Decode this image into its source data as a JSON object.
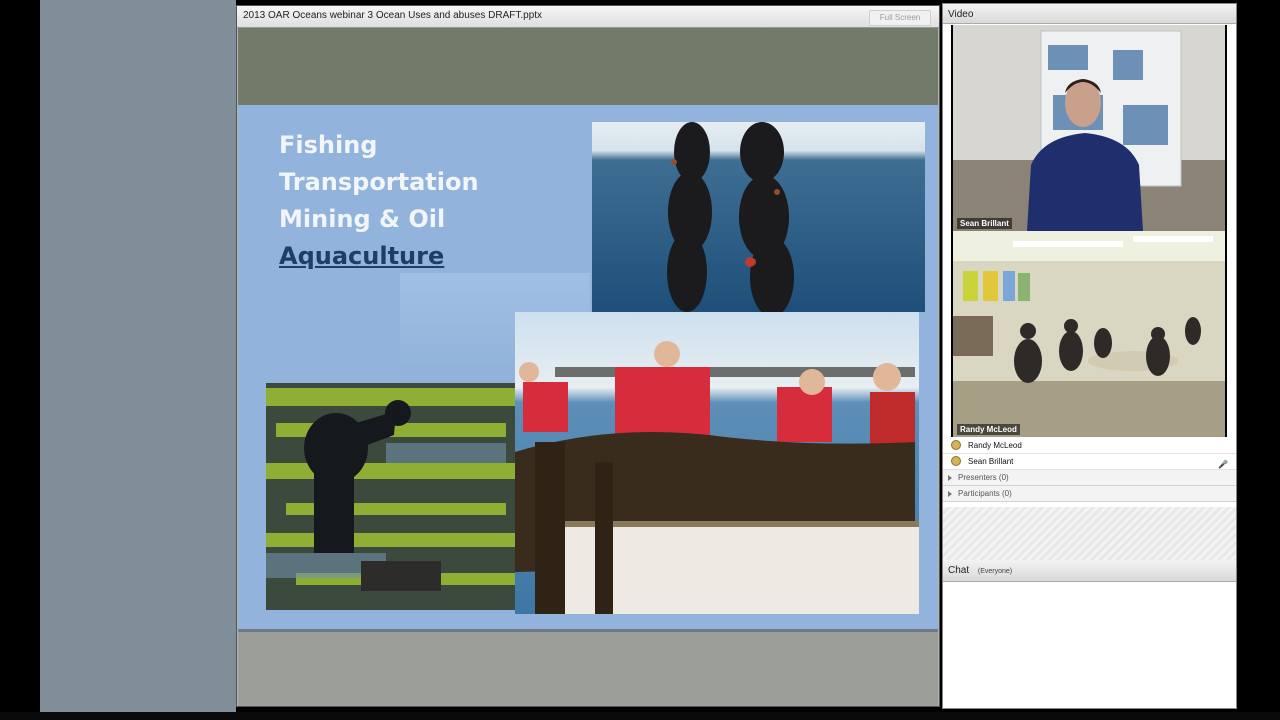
{
  "presentation": {
    "file_title": "2013 OAR Oceans webinar 3 Ocean Uses and abuses DRAFT.pptx",
    "fullscreen_label": "Full Screen",
    "slide": {
      "bullets": [
        "Fishing",
        "Transportation",
        "Mining & Oil",
        "Aquaculture"
      ],
      "highlighted_bullet": "Aquaculture"
    }
  },
  "video_pod": {
    "title": "Video",
    "feeds": [
      {
        "name": "Sean Brillant"
      },
      {
        "name": "Randy McLeod"
      }
    ]
  },
  "attendees": {
    "hosts": [
      {
        "name": "Randy McLeod",
        "icon": "host-icon"
      },
      {
        "name": "Sean Brillant",
        "icon": "host-icon",
        "extra_icon": "microphone-icon"
      }
    ],
    "presenters_label": "Presenters (0)",
    "participants_label": "Participants (0)"
  },
  "chat": {
    "title": "Chat",
    "scope": "(Everyone)"
  },
  "colors": {
    "slide_bg": "#92b3dc",
    "bullet_text": "#f2f5fa",
    "active_bullet": "#1f3d68"
  }
}
